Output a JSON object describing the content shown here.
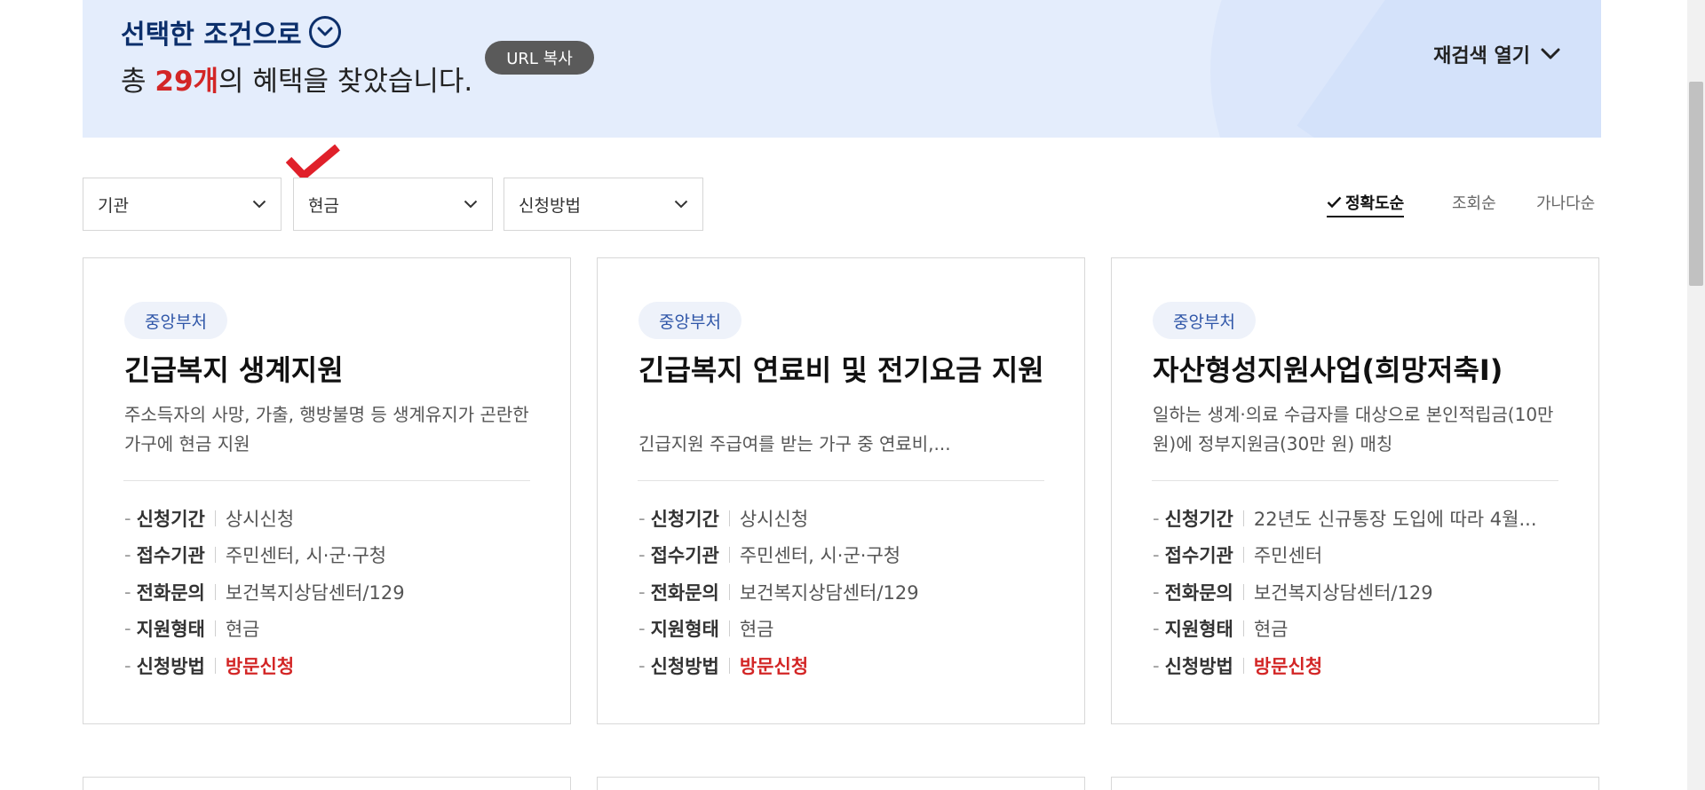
{
  "banner": {
    "title": "선택한 조건으로",
    "result_prefix": "총 ",
    "result_count": "29개",
    "result_suffix": "의 혜택을 찾았습니다.",
    "url_copy_label": "URL 복사",
    "research_label": "재검색 열기"
  },
  "filters": [
    {
      "label": "기관"
    },
    {
      "label": "현금"
    },
    {
      "label": "신청방법"
    }
  ],
  "sort": {
    "options": [
      "정확도순",
      "조회순",
      "가나다순"
    ],
    "active": "정확도순"
  },
  "cards": [
    {
      "badge": "중앙부처",
      "title": "긴급복지 생계지원",
      "desc": "주소득자의 사망, 가출, 행방불명 등 생계유지가 곤란한 가구에 현금 지원",
      "info": [
        {
          "label": "신청기간",
          "value": "상시신청"
        },
        {
          "label": "접수기관",
          "value": "주민센터, 시·군·구청"
        },
        {
          "label": "전화문의",
          "value": "보건복지상담센터/129"
        },
        {
          "label": "지원형태",
          "value": "현금"
        },
        {
          "label": "신청방법",
          "value": "방문신청"
        }
      ]
    },
    {
      "badge": "중앙부처",
      "title": "긴급복지 연료비 및 전기요금 지원",
      "desc": "긴급지원 주급여를 받는 가구 중 연료비,...",
      "info": [
        {
          "label": "신청기간",
          "value": "상시신청"
        },
        {
          "label": "접수기관",
          "value": "주민센터, 시·군·구청"
        },
        {
          "label": "전화문의",
          "value": "보건복지상담센터/129"
        },
        {
          "label": "지원형태",
          "value": "현금"
        },
        {
          "label": "신청방법",
          "value": "방문신청"
        }
      ]
    },
    {
      "badge": "중앙부처",
      "title": "자산형성지원사업(희망저축Ⅰ)",
      "desc": "일하는 생계·의료 수급자를 대상으로 본인적립금(10만 원)에 정부지원금(30만 원) 매칭",
      "info": [
        {
          "label": "신청기간",
          "value": "22년도 신규통장 도입에 따라 4월..."
        },
        {
          "label": "접수기관",
          "value": "주민센터"
        },
        {
          "label": "전화문의",
          "value": "보건복지상담센터/129"
        },
        {
          "label": "지원형태",
          "value": "현금"
        },
        {
          "label": "신청방법",
          "value": "방문신청"
        }
      ]
    }
  ],
  "colors": {
    "banner_bg": "#e4edfc",
    "title_navy": "#0c2f6b",
    "accent_red": "#d32626",
    "badge_blue": "#2f56a8"
  }
}
